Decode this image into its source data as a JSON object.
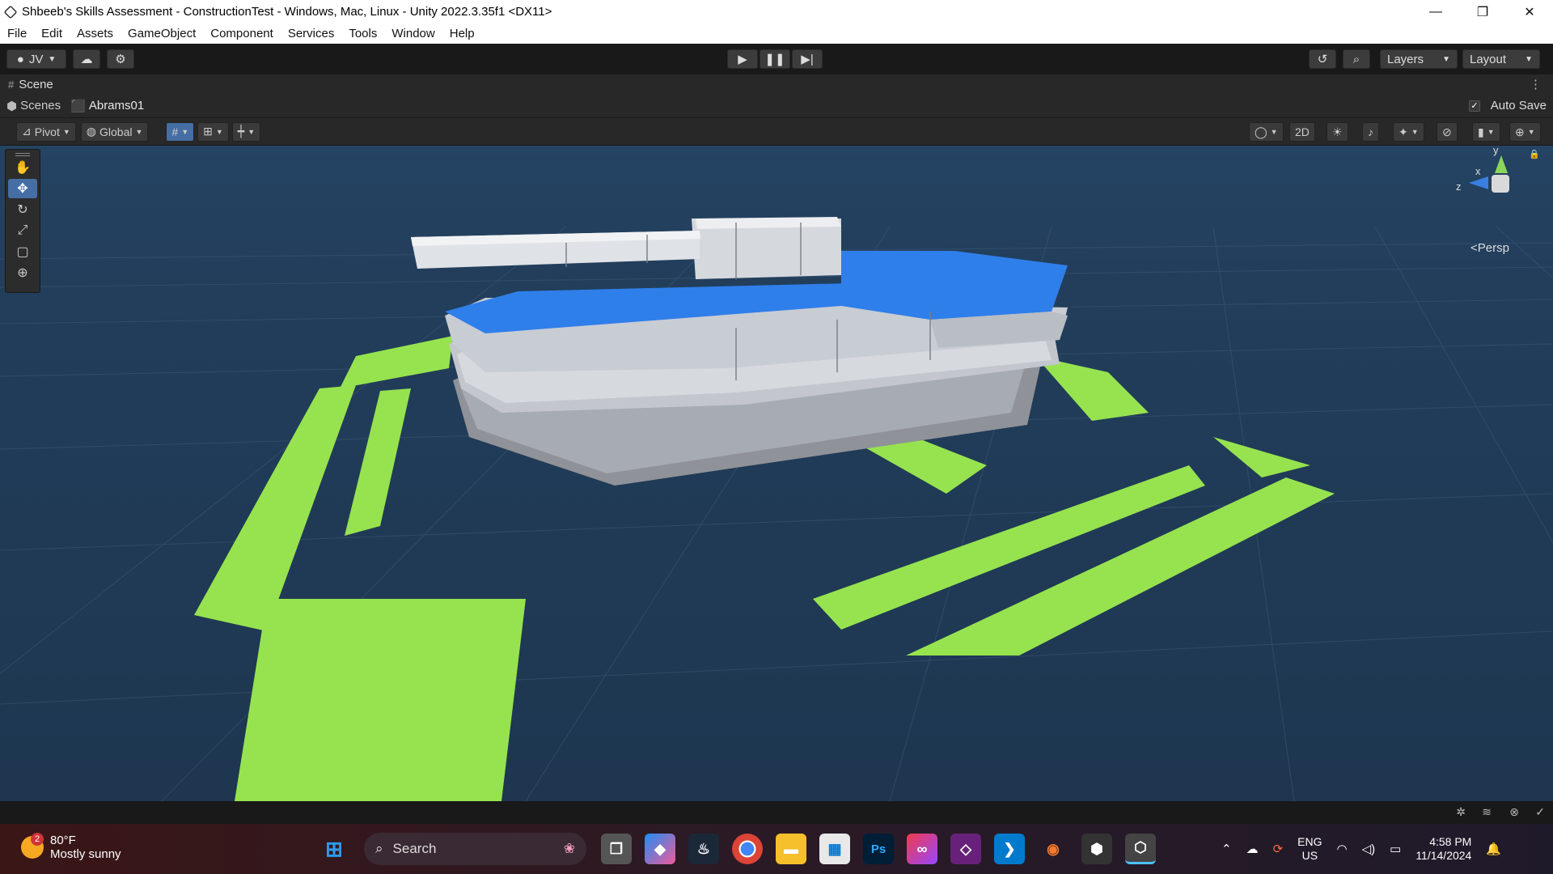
{
  "window": {
    "title": "Shbeeb's Skills Assessment - ConstructionTest - Windows, Mac, Linux - Unity 2022.3.35f1 <DX11>",
    "minimize": "—",
    "maximize": "❐",
    "close": "✕"
  },
  "menu": [
    "File",
    "Edit",
    "Assets",
    "GameObject",
    "Component",
    "Services",
    "Tools",
    "Window",
    "Help"
  ],
  "toolbar": {
    "account": "JV",
    "layers": "Layers",
    "layout": "Layout"
  },
  "scene_tab": {
    "label": "Scene"
  },
  "breadcrumb": {
    "scenes": "Scenes",
    "object": "Abrams01",
    "auto_save": "Auto Save",
    "auto_save_checked": true
  },
  "scene_tools": {
    "pivot": "Pivot",
    "global": "Global",
    "mode_2d": "2D"
  },
  "gizmo": {
    "x": "x",
    "y": "y",
    "z": "z",
    "projection": "Persp"
  },
  "taskbar": {
    "weather_temp": "80°F",
    "weather_desc": "Mostly sunny",
    "weather_badge": "2",
    "search": "Search",
    "lang": "ENG",
    "region": "US",
    "time": "4:58 PM",
    "date": "11/14/2024"
  },
  "colors": {
    "viewport_bg": "#223d59",
    "ground_tiles": "#96e34f",
    "tank_body": "#c8ccd3",
    "tank_accent": "#2f7fea",
    "editor_dark": "#191919",
    "active_tool": "#456ea4"
  }
}
